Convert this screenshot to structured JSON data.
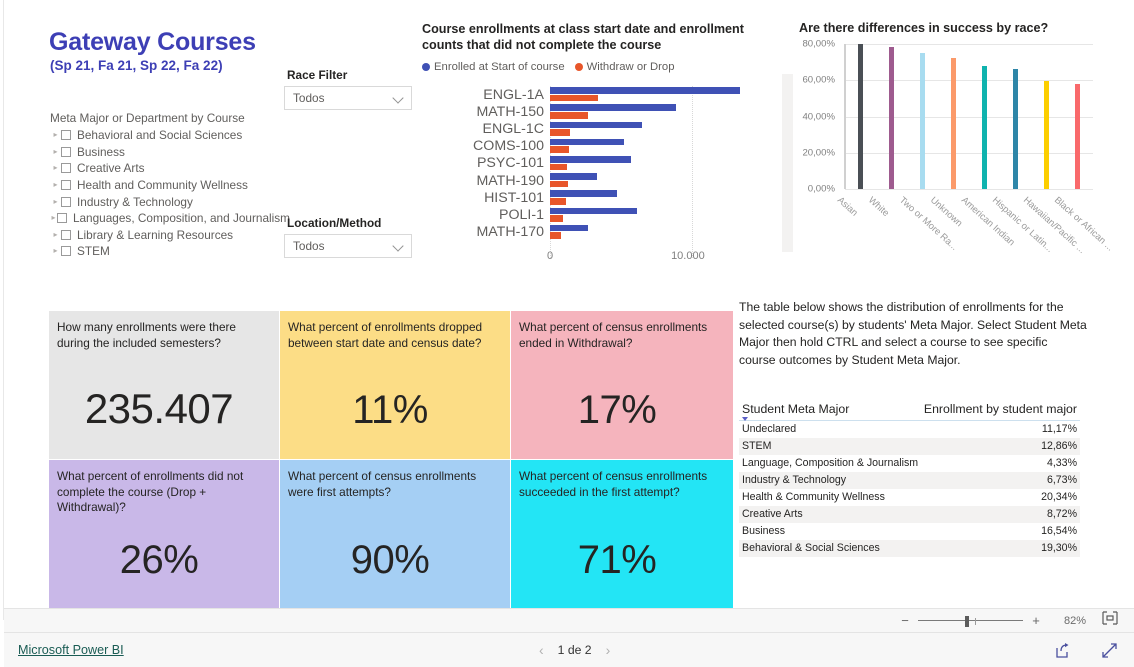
{
  "report": {
    "title": "Gateway Courses",
    "subtitle": "(Sp 21, Fa 21, Sp 22, Fa 22)"
  },
  "tree_filter": {
    "header": "Meta Major or Department by Course",
    "items": [
      "Behavioral and Social Sciences",
      "Business",
      "Creative Arts",
      "Health and Community Wellness",
      "Industry & Technology",
      "Languages, Composition, and Journalism",
      "Library & Learning Resources",
      "STEM"
    ]
  },
  "slicers": [
    {
      "label": "Race Filter",
      "value": "Todos"
    },
    {
      "label": "Location/Method",
      "value": "Todos"
    }
  ],
  "chart_data": [
    {
      "type": "bar",
      "orientation": "horizontal",
      "title": "Course enrollments at class start date and enrollment counts that did not complete the course",
      "categories": [
        "ENGL-1A",
        "MATH-150",
        "ENGL-1C",
        "COMS-100",
        "PSYC-101",
        "MATH-190",
        "HIST-101",
        "POLI-1",
        "MATH-170"
      ],
      "series": [
        {
          "name": "Enrolled at Start of course",
          "color": "#3f51b5",
          "values": [
            13400,
            8900,
            6500,
            5200,
            5700,
            3300,
            4700,
            6100,
            2700
          ]
        },
        {
          "name": "Withdraw or Drop",
          "color": "#e8562a",
          "values": [
            3400,
            2700,
            1400,
            1300,
            1200,
            1250,
            1100,
            900,
            800
          ]
        }
      ],
      "xlabel": "",
      "ylabel": "",
      "xticks": [
        "0",
        "10.000"
      ],
      "xlim": [
        0,
        14500
      ],
      "grid": true,
      "legend_position": "top"
    },
    {
      "type": "bar",
      "orientation": "vertical",
      "title": "Are there differences in success by race?",
      "categories": [
        "Asian",
        "White",
        "Two or More Ra...",
        "Unknown",
        "American Indian",
        "Hispanic or Latin...",
        "Hawaiian/Pacific ...",
        "Black or African ..."
      ],
      "values": [
        80.0,
        78.3,
        75.2,
        72.3,
        67.8,
        66.1,
        59.5,
        58.2
      ],
      "colors": [
        "#4a4f55",
        "#9e5b8f",
        "#a8dcf0",
        "#fb9a6a",
        "#0fb3ae",
        "#2e86a8",
        "#fcce00",
        "#f9696b"
      ],
      "yticks": [
        "0,00%",
        "20,00%",
        "40,00%",
        "60,00%",
        "80,00%"
      ],
      "ylim": [
        0,
        80
      ],
      "xlabel": "",
      "ylabel": "",
      "grid": true,
      "legend_position": "none"
    }
  ],
  "kpis": [
    {
      "question": "How many enrollments were there during the included semesters?",
      "value": "235.407",
      "bg": "#e6e6e6",
      "wide": true
    },
    {
      "question": "What percent of enrollments dropped between start date and census date?",
      "value": "11%",
      "bg": "#fcdd86"
    },
    {
      "question": "What percent of census enrollments ended in Withdrawal?",
      "value": "17%",
      "bg": "#f5b4bd"
    },
    {
      "question": "What percent of enrollments did not complete the course (Drop + Withdrawal)?",
      "value": "26%",
      "bg": "#c9b8e8"
    },
    {
      "question": "What percent of census enrollments were first attempts?",
      "value": "90%",
      "bg": "#a5cff4"
    },
    {
      "question": "What percent of census enrollments succeeded in the first attempt?",
      "value": "71%",
      "bg": "#23e5f5"
    }
  ],
  "table_panel": {
    "description": "The table below shows the distribution of enrollments for the selected course(s) by students' Meta Major.   Select Student Meta Major then hold CTRL and select a course to see specific course outcomes by Student Meta Major.",
    "columns": [
      "Student Meta Major",
      "Enrollment by student major"
    ],
    "rows": [
      {
        "major": "Undeclared",
        "pct": "11,17%"
      },
      {
        "major": "STEM",
        "pct": "12,86%"
      },
      {
        "major": "Language, Composition & Journalism",
        "pct": "4,33%"
      },
      {
        "major": "Industry & Technology",
        "pct": "6,73%"
      },
      {
        "major": "Health & Community Wellness",
        "pct": "20,34%"
      },
      {
        "major": "Creative Arts",
        "pct": "8,72%"
      },
      {
        "major": "Business",
        "pct": "16,54%"
      },
      {
        "major": "Behavioral & Social Sciences",
        "pct": "19,30%"
      }
    ]
  },
  "toolbar": {
    "zoom_out": "−",
    "zoom_in": "+",
    "zoom_level": "82%"
  },
  "footer": {
    "brand": "Microsoft Power BI",
    "page_indicator": "1 de 2",
    "prev": "‹",
    "next": "›"
  }
}
